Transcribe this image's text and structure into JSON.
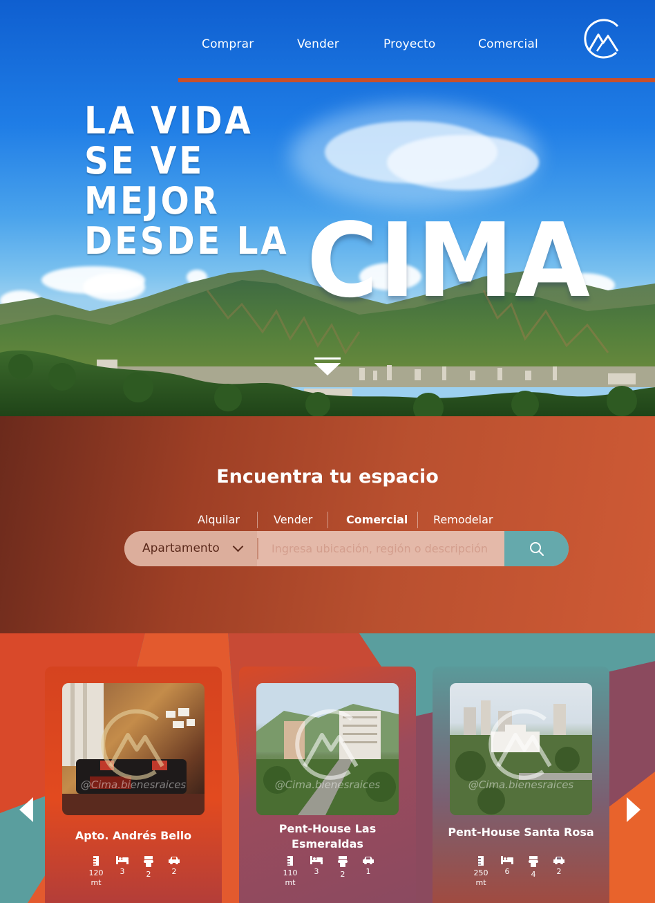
{
  "nav": {
    "items": [
      {
        "label": "Comprar"
      },
      {
        "label": "Vender"
      },
      {
        "label": "Proyecto"
      },
      {
        "label": "Comercial"
      }
    ],
    "logo_icon": "mountain-circle-logo"
  },
  "hero": {
    "slogan_lines": [
      "LA VIDA",
      "SE VE",
      "MEJOR",
      "DESDE LA"
    ],
    "brand_word": "CIMA",
    "scroll_icon": "triangle-down-icon"
  },
  "search": {
    "title": "Encuentra tu espacio",
    "tabs": [
      {
        "label": "Alquilar",
        "active": false
      },
      {
        "label": "Vender",
        "active": false
      },
      {
        "label": "Comercial",
        "active": true
      },
      {
        "label": "Remodelar",
        "active": false
      }
    ],
    "property_type": "Apartamento",
    "placeholder": "Ingresa ubicación, región o descripción",
    "button_icon": "search-icon"
  },
  "listings": {
    "watermark": "@Cima.bienesraices",
    "prev_icon": "chevron-left-icon",
    "next_icon": "chevron-right-icon",
    "cards": [
      {
        "title": "Apto. Andrés Bello",
        "area": "120",
        "area_unit": "mt",
        "bedrooms": "3",
        "bathrooms": "2",
        "parking": "2"
      },
      {
        "title": "Pent-House Las Esmeraldas",
        "area": "110",
        "area_unit": "mt",
        "bedrooms": "3",
        "bathrooms": "2",
        "parking": "1"
      },
      {
        "title": "Pent-House Santa Rosa",
        "area": "250",
        "area_unit": "mt",
        "bedrooms": "6",
        "bathrooms": "4",
        "parking": "2"
      }
    ]
  },
  "colors": {
    "accent": "#c8502c",
    "teal": "#65a9ac",
    "sky": "#1b6fd0"
  }
}
